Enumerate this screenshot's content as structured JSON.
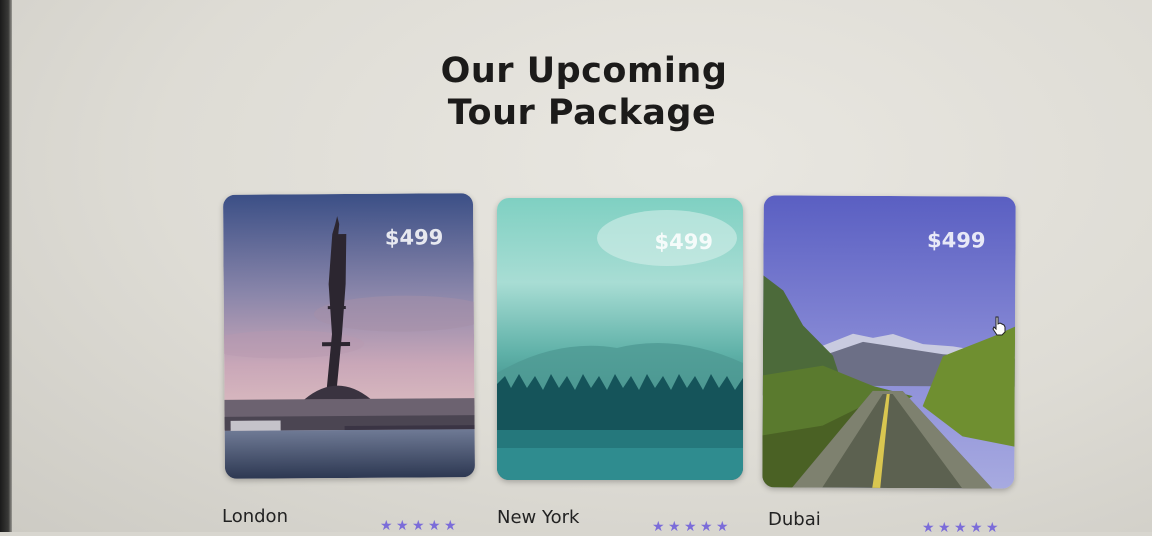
{
  "section": {
    "title_line1": "Our Upcoming",
    "title_line2": "Tour Package"
  },
  "packages": [
    {
      "city": "London",
      "price": "$499",
      "rating": 5
    },
    {
      "city": "New York",
      "price": "$499",
      "rating": 5
    },
    {
      "city": "Dubai",
      "price": "$499",
      "rating": 5
    }
  ],
  "colors": {
    "star": "#7b6cd9",
    "heading": "#1c1b1a",
    "background": "#e3e1da"
  },
  "icons": {
    "rating": "star-icon",
    "cursor": "hand-pointer-icon"
  }
}
